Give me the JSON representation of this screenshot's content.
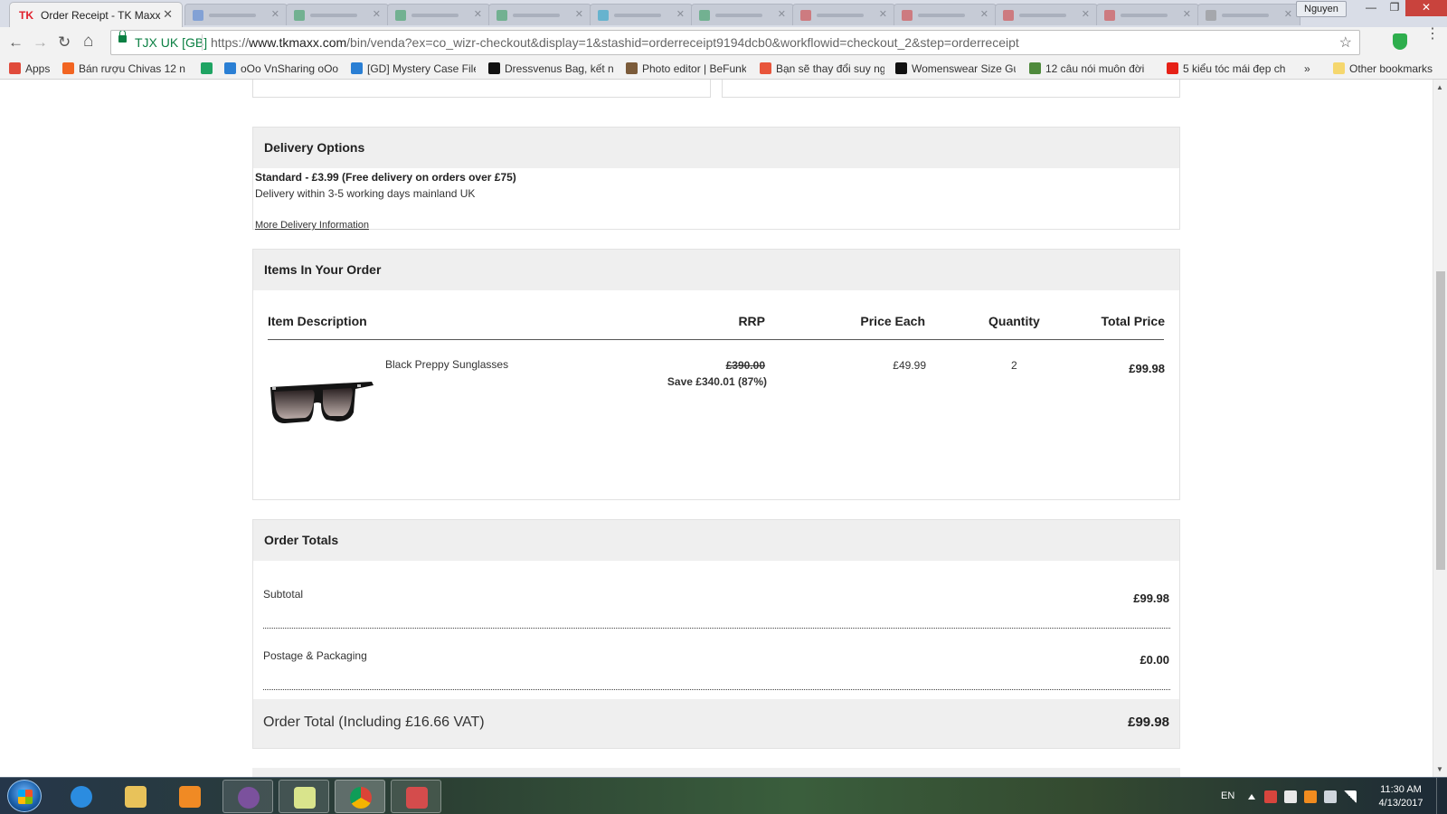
{
  "browser": {
    "active_tab": {
      "favicon_text": "TK",
      "title": "Order Receipt - TK Maxx",
      "close": "✕"
    },
    "background_tabs": [
      {
        "favicon_color": "#4a7fd6"
      },
      {
        "favicon_color": "#2e9d5a"
      },
      {
        "favicon_color": "#2e9d5a"
      },
      {
        "favicon_color": "#2e9d5a"
      },
      {
        "favicon_color": "#1aa0c8"
      },
      {
        "favicon_color": "#2e9d5a"
      },
      {
        "favicon_color": "#d43a3a"
      },
      {
        "favicon_color": "#d43a3a"
      },
      {
        "favicon_color": "#d43a3a"
      },
      {
        "favicon_color": "#d43a3a"
      },
      {
        "favicon_color": "#8a8a8a"
      }
    ],
    "profile_name": "Nguyen",
    "window_buttons": {
      "minimize": "—",
      "maximize": "❐",
      "close": "✕"
    },
    "nav": {
      "back": "←",
      "forward": "→",
      "reload": "↻",
      "home": "⌂"
    },
    "site_identity": "TJX UK [GB]",
    "url_prefix": "https://",
    "url_domain": "www.tkmaxx.com",
    "url_path": "/bin/venda?ex=co_wizr-checkout&display=1&stashid=orderreceipt9194dcb0&workflowid=checkout_2&step=orderreceipt",
    "star_icon": "☆",
    "menu_icon": "⋮",
    "bookmarks": [
      {
        "label": "Apps",
        "icon_color": "#e04b3b"
      },
      {
        "label": "Bán rượu Chivas 12 n",
        "icon_color": "#f26522"
      },
      {
        "label": "",
        "icon_color": "#1fa463"
      },
      {
        "label": "oOo VnSharing oOo",
        "icon_color": "#2a7fd4"
      },
      {
        "label": "[GD] Mystery Case File",
        "icon_color": "#2a7fd4"
      },
      {
        "label": "Dressvenus Bag, kết n",
        "icon_color": "#111111"
      },
      {
        "label": "Photo editor | BeFunk",
        "icon_color": "#7b5b3a"
      },
      {
        "label": "Bạn sẽ thay đổi suy ng",
        "icon_color": "#e8553b"
      },
      {
        "label": "Womenswear Size Gu",
        "icon_color": "#111111"
      },
      {
        "label": "12 câu nói muôn đời",
        "icon_color": "#4f8a3c"
      },
      {
        "label": "5 kiểu tóc mái đẹp ch",
        "icon_color": "#e62117"
      }
    ],
    "bookmarks_overflow": "»",
    "other_bookmarks": "Other bookmarks"
  },
  "delivery": {
    "heading": "Delivery Options",
    "option": "Standard - £3.99 (Free delivery on orders over £75)",
    "description": "Delivery within 3-5 working days mainland UK",
    "more_link": "More Delivery Information"
  },
  "items": {
    "heading": "Items In Your Order",
    "columns": {
      "description": "Item Description",
      "rrp": "RRP",
      "price_each": "Price Each",
      "quantity": "Quantity",
      "total_price": "Total Price"
    },
    "rows": [
      {
        "name": "Black Preppy Sunglasses",
        "rrp": "£390.00",
        "saving": "Save £340.01 (87%)",
        "price_each": "£49.99",
        "quantity": "2",
        "total": "£99.98"
      }
    ]
  },
  "totals": {
    "heading": "Order Totals",
    "subtotal_label": "Subtotal",
    "subtotal": "£99.98",
    "postage_label": "Postage & Packaging",
    "postage": "£0.00",
    "order_total_label": "Order Total (Including £16.66 VAT)",
    "order_total": "£99.98"
  },
  "taskbar": {
    "language": "EN",
    "time": "11:30 AM",
    "date": "4/13/2017"
  },
  "colors": {
    "brand_red": "#e0202b",
    "secure_green": "#0b8043",
    "panel_header_bg": "#efefef"
  }
}
